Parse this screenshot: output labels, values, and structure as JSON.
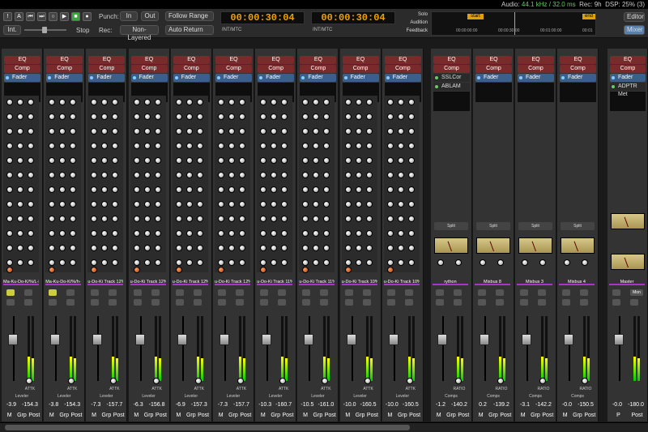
{
  "status": {
    "audio_label": "Audio:",
    "audio_value": "44.1 kHz / 32.0 ms",
    "rec": "Rec: 9h",
    "dsp": "DSP: 25% (3)"
  },
  "transport": {
    "int_label": "Int.",
    "stop_label": "Stop",
    "punch_label": "Punch:",
    "punch_in": "In",
    "punch_out": "Out",
    "rec_label": "Rec:",
    "rec_mode": "Non-Layered",
    "follow_range": "Follow Range",
    "auto_return": "Auto Return",
    "counter1": "00:00:30:04",
    "counter1_src": "INT/MTC",
    "counter2": "00:00:30:04",
    "counter2_src": "INT/MTC",
    "solo": "Solo",
    "audition": "Audition",
    "feedback": "Feedback",
    "timeline_start": "start",
    "timeline_end": "end",
    "tl_ticks": [
      "00:00:00:00",
      "00:00:30:00",
      "00:01:00:00",
      "00:01"
    ],
    "editor": "Editor",
    "mixer": "Mixer"
  },
  "strips": [
    {
      "name": "Ma-Ku-Do-K/%/L-L",
      "slots": [
        "EQ",
        "Comp",
        "Fader"
      ],
      "val1": "-3.9",
      "val2": "-154.3",
      "mode": "Leveler",
      "knob": "ATTK",
      "bottom": [
        "M",
        "Grp",
        "Post"
      ],
      "yellow": true
    },
    {
      "name": "Ma-Ku-Do-K/%/h-R",
      "slots": [
        "EQ",
        "Comp",
        "Fader"
      ],
      "val1": "-3.8",
      "val2": "-154.3",
      "mode": "Leveler",
      "knob": "ATTK",
      "bottom": [
        "M",
        "Grp",
        "Post"
      ],
      "yellow": true
    },
    {
      "name": "u-Do-Ki Track 12%",
      "slots": [
        "EQ",
        "Comp",
        "Fader"
      ],
      "val1": "-7.3",
      "val2": "-157.7",
      "mode": "Leveler",
      "knob": "ATTK",
      "bottom": [
        "M",
        "Grp",
        "Post"
      ],
      "yellow": false
    },
    {
      "name": "u-Do-Ki Track 12%",
      "slots": [
        "EQ",
        "Comp",
        "Fader"
      ],
      "val1": "-6.3",
      "val2": "-156.8",
      "mode": "Leveler",
      "knob": "ATTK",
      "bottom": [
        "M",
        "Grp",
        "Post"
      ],
      "yellow": false
    },
    {
      "name": "u-Do-Ki Track 12%",
      "slots": [
        "EQ",
        "Comp",
        "Fader"
      ],
      "val1": "-6.9",
      "val2": "-157.3",
      "mode": "Leveler",
      "knob": "ATTK",
      "bottom": [
        "M",
        "Grp",
        "Post"
      ],
      "yellow": false
    },
    {
      "name": "u-Do-Ki Track 12%",
      "slots": [
        "EQ",
        "Comp",
        "Fader"
      ],
      "val1": "-7.3",
      "val2": "-157.7",
      "mode": "Leveler",
      "knob": "ATTK",
      "bottom": [
        "M",
        "Grp",
        "Post"
      ],
      "yellow": false
    },
    {
      "name": "u-Do-Ki Track 11%",
      "slots": [
        "EQ",
        "Comp",
        "Fader"
      ],
      "val1": "-10.3",
      "val2": "-160.7",
      "mode": "Leveler",
      "knob": "ATTK",
      "bottom": [
        "M",
        "Grp",
        "Post"
      ],
      "yellow": false
    },
    {
      "name": "u-Do-Ki Track 11%",
      "slots": [
        "EQ",
        "Comp",
        "Fader"
      ],
      "val1": "-10.5",
      "val2": "-161.0",
      "mode": "Leveler",
      "knob": "ATTK",
      "bottom": [
        "M",
        "Grp",
        "Post"
      ],
      "yellow": false
    },
    {
      "name": "u-Do-Ki Track 10%",
      "slots": [
        "EQ",
        "Comp",
        "Fader"
      ],
      "val1": "-10.0",
      "val2": "-160.5",
      "mode": "Leveler",
      "knob": "ATTK",
      "bottom": [
        "M",
        "Grp",
        "Post"
      ],
      "yellow": false
    },
    {
      "name": "u-Do-Ki Track 10%",
      "slots": [
        "EQ",
        "Comp",
        "Fader"
      ],
      "val1": "-10.0",
      "val2": "-160.5",
      "mode": "Leveler",
      "knob": "ATTK",
      "bottom": [
        "M",
        "Grp",
        "Post"
      ],
      "yellow": false
    }
  ],
  "buses": [
    {
      "name": "rython",
      "slots": [
        "EQ",
        "Comp",
        "SSLCor",
        "ABLAM"
      ],
      "split": "Split",
      "val1": "-1.2",
      "val2": "-140.2",
      "mode": "Comps",
      "knob": "RATIO",
      "bottom": [
        "M",
        "Grp",
        "Post"
      ]
    },
    {
      "name": "Mixbus 8",
      "slots": [
        "EQ",
        "Comp",
        "Fader"
      ],
      "split": "Split",
      "val1": "0.2",
      "val2": "-139.2",
      "mode": "Comps",
      "knob": "RATIO",
      "bottom": [
        "M",
        "Grp",
        "Post"
      ]
    },
    {
      "name": "Mixbus 3",
      "slots": [
        "EQ",
        "Comp",
        "Fader"
      ],
      "split": "Split",
      "val1": "-3.1",
      "val2": "-142.2",
      "mode": "Comps",
      "knob": "RATIO",
      "bottom": [
        "M",
        "Grp",
        "Post"
      ]
    },
    {
      "name": "Mixbus 4",
      "slots": [
        "EQ",
        "Comp",
        "Fader"
      ],
      "split": "Split",
      "val1": "-0.0",
      "val2": "-150.5",
      "mode": "Comps",
      "knob": "RATIO",
      "bottom": [
        "M",
        "Grp",
        "Post"
      ]
    }
  ],
  "master": {
    "name": "Master",
    "slots": [
      "EQ",
      "Comp",
      "Fader",
      "ADPTR Met"
    ],
    "val1": "-0.0",
    "val2": "-180.0",
    "bottom": [
      "P",
      "Post"
    ],
    "mon": "Mon"
  }
}
